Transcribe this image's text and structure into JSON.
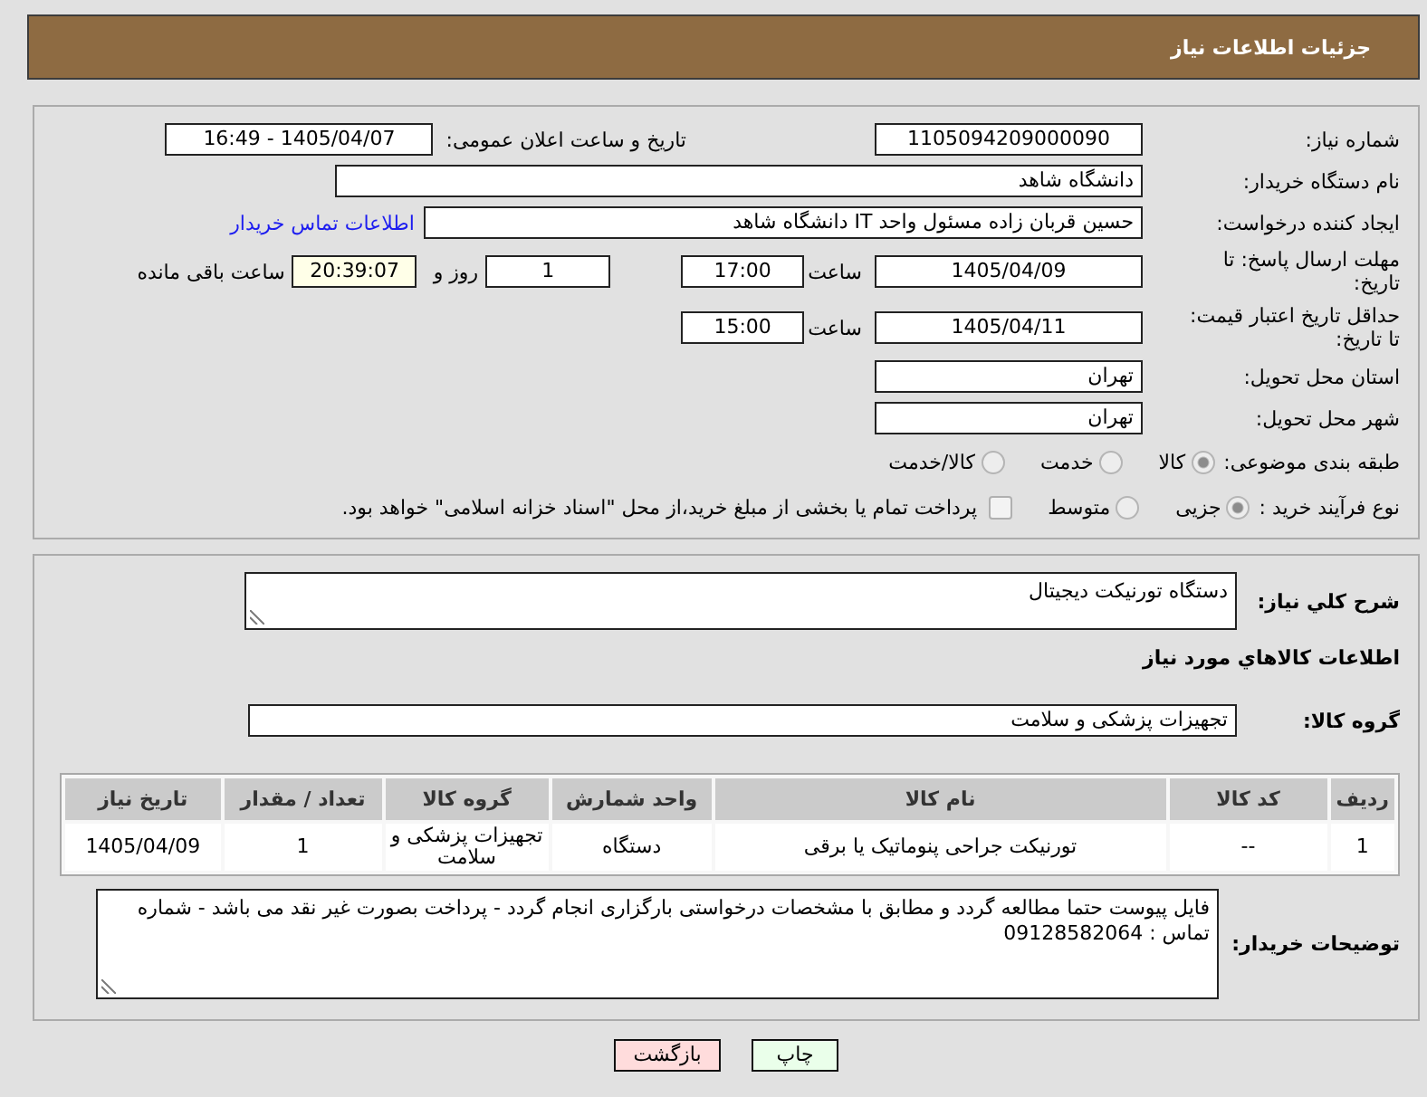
{
  "header": {
    "title": "جزئیات اطلاعات نیاز"
  },
  "details": {
    "need_number": {
      "label": "شماره نیاز:",
      "value": "1105094209000090"
    },
    "announce_datetime": {
      "label": "تاریخ و ساعت اعلان عمومی:",
      "value": "1405/04/07 - 16:49"
    },
    "buyer_org": {
      "label": "نام دستگاه خریدار:",
      "value": "دانشگاه شاهد"
    },
    "requester": {
      "label": "ایجاد کننده درخواست:",
      "value": "حسین قربان زاده مسئول واحد IT دانشگاه شاهد",
      "contact_link": "اطلاعات تماس خریدار"
    },
    "response_deadline": {
      "label": "مهلت ارسال پاسخ: تا تاریخ:",
      "date": "1405/04/09",
      "time_label": "ساعت",
      "time": "17:00",
      "days": "1",
      "days_label": "روز و",
      "remaining": "20:39:07",
      "remaining_label": "ساعت باقی مانده"
    },
    "price_validity": {
      "label": "حداقل تاریخ اعتبار قیمت: تا تاریخ:",
      "date": "1405/04/11",
      "time_label": "ساعت",
      "time": "15:00"
    },
    "delivery_province": {
      "label": "استان محل تحویل:",
      "value": "تهران"
    },
    "delivery_city": {
      "label": "شهر محل تحویل:",
      "value": "تهران"
    },
    "subject_category": {
      "label": "طبقه بندی موضوعی:",
      "options": [
        {
          "label": "کالا",
          "selected": true
        },
        {
          "label": "خدمت",
          "selected": false
        },
        {
          "label": "کالا/خدمت",
          "selected": false
        }
      ]
    },
    "purchase_process": {
      "label": "نوع فرآیند خرید :",
      "options": [
        {
          "label": "جزیی",
          "selected": true
        },
        {
          "label": "متوسط",
          "selected": false
        }
      ],
      "treasury_payment": {
        "label": "پرداخت تمام یا بخشی از مبلغ خرید،از محل \"اسناد خزانه اسلامی\" خواهد بود.",
        "checked": false
      }
    }
  },
  "need": {
    "description_label": "شرح کلي نياز:",
    "description": "دستگاه تورنیکت دیجیتال",
    "items_heading": "اطلاعات كالاهاي مورد نياز",
    "group_label": "گروه کالا:",
    "group": "تجهیزات پزشکی و سلامت",
    "table": {
      "columns": [
        "ردیف",
        "کد کالا",
        "نام کالا",
        "واحد شمارش",
        "گروه کالا",
        "تعداد / مقدار",
        "تاریخ نیاز"
      ],
      "rows": [
        [
          "1",
          "--",
          "تورنیکت جراحی پنوماتیک یا برقی",
          "دستگاه",
          "تجهیزات پزشکی و سلامت",
          "1",
          "1405/04/09"
        ]
      ]
    },
    "notes_label": "توضیحات خریدار:",
    "notes": "فایل پیوست حتما مطالعه گردد و مطابق با مشخصات درخواستی بارگزاری انجام گردد - پرداخت بصورت غیر نقد می باشد - شماره تماس : 09128582064"
  },
  "buttons": [
    {
      "kind": "print",
      "label": "چاپ"
    },
    {
      "kind": "back",
      "label": "بازگشت"
    }
  ]
}
